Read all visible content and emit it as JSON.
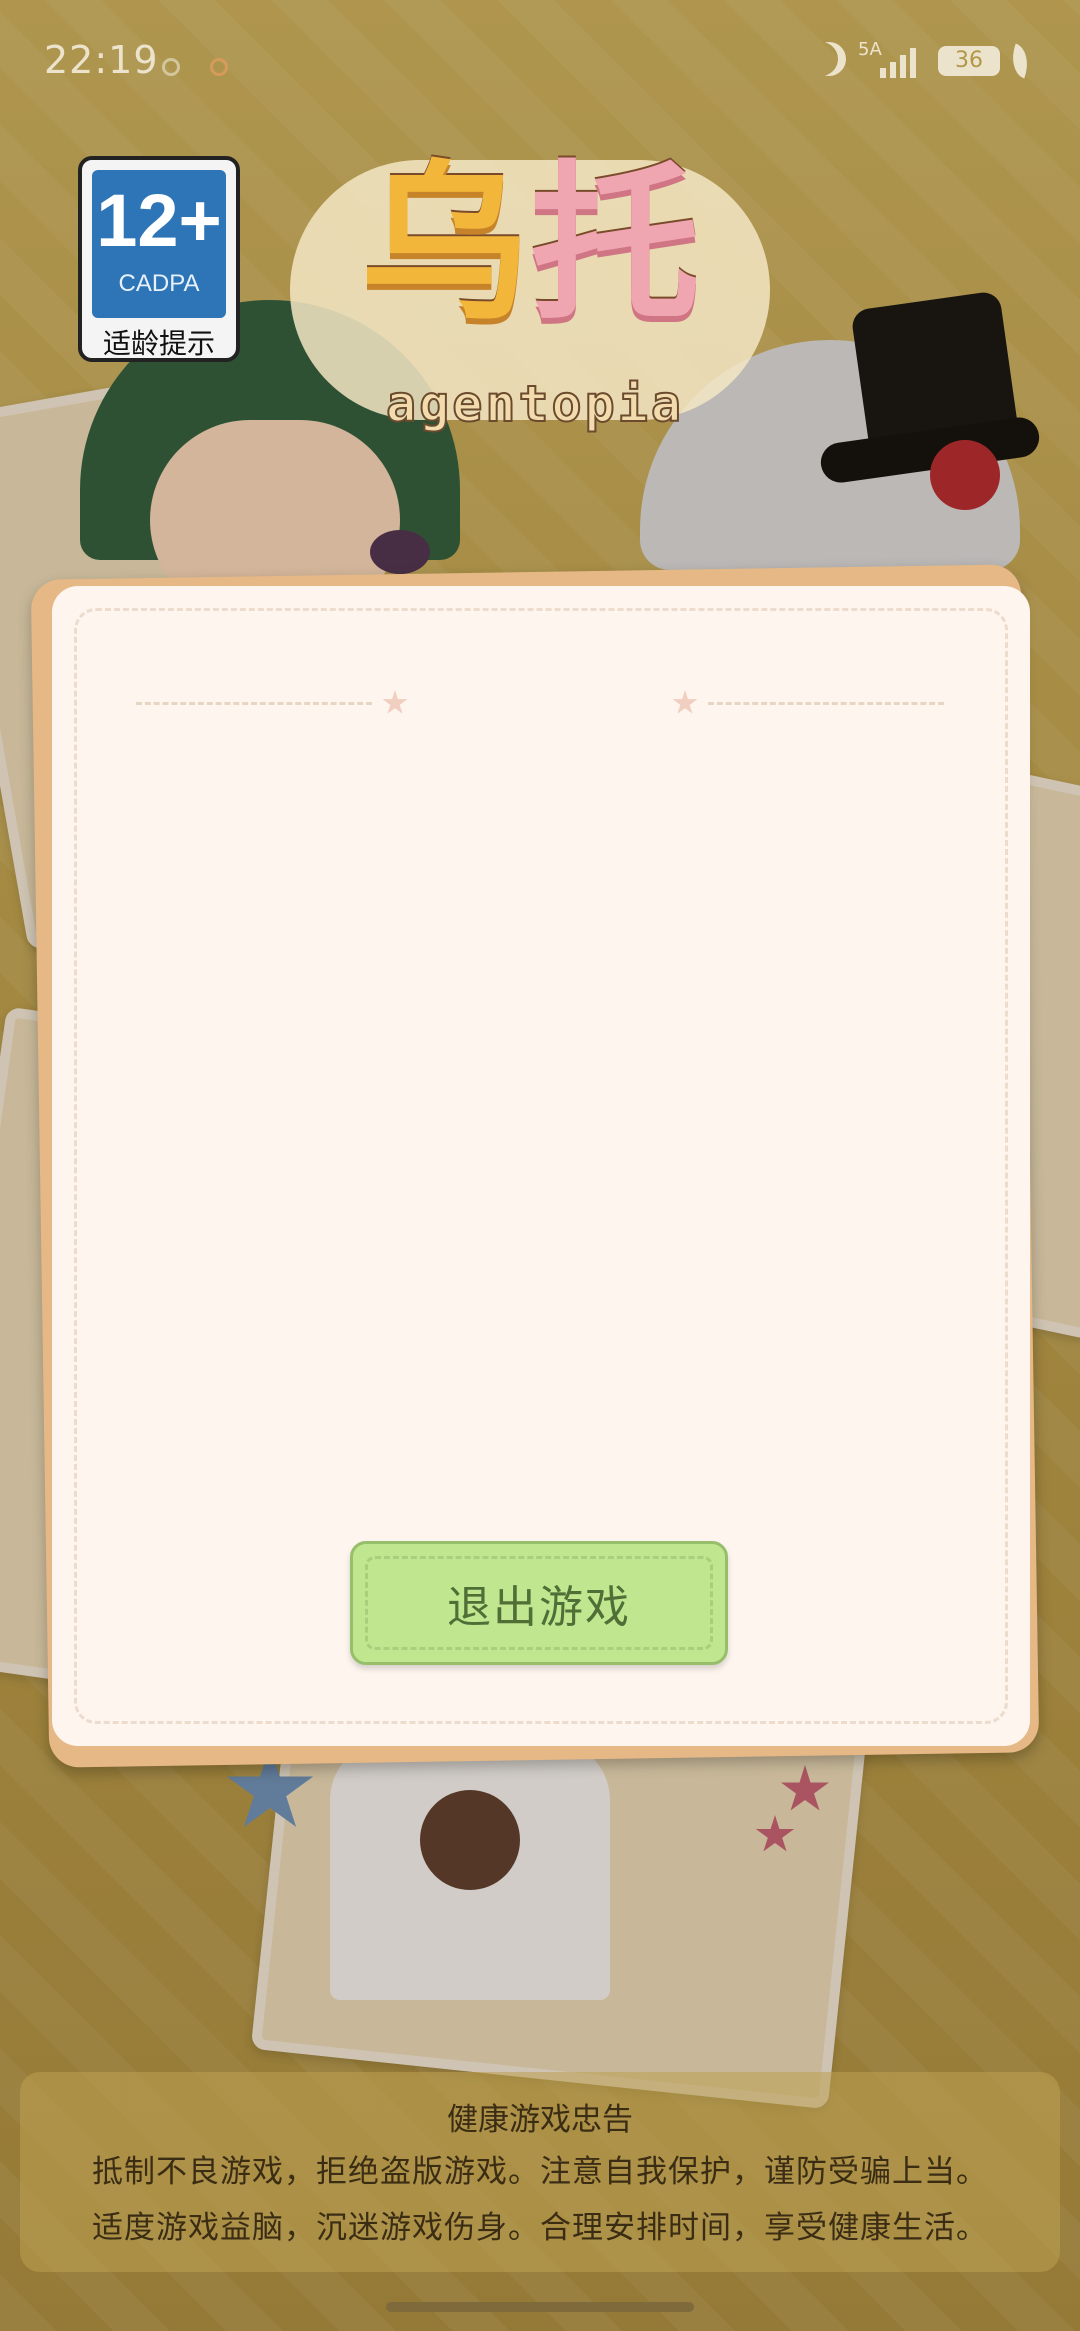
{
  "status_bar": {
    "time": "22:19",
    "network": "5A",
    "battery": "36"
  },
  "age_rating": {
    "rating": "12+",
    "org": "CADPA",
    "label": "适龄提示"
  },
  "logo": {
    "title_cn_1": "乌",
    "title_cn_2": "托",
    "subtitle": "agentopia"
  },
  "dialog": {
    "exit_button": "退出游戏"
  },
  "health_notice": {
    "title": "健康游戏忠告",
    "line1": "抵制不良游戏，拒绝盗版游戏。注意自我保护，谨防受骗上当。",
    "line2": "适度游戏益脑，沉迷游戏伤身。合理安排时间，享受健康生活。"
  },
  "colors": {
    "accent_green": "#c0e690",
    "dialog_bg": "#fdf5ee",
    "badge_blue": "#2e75b7"
  }
}
